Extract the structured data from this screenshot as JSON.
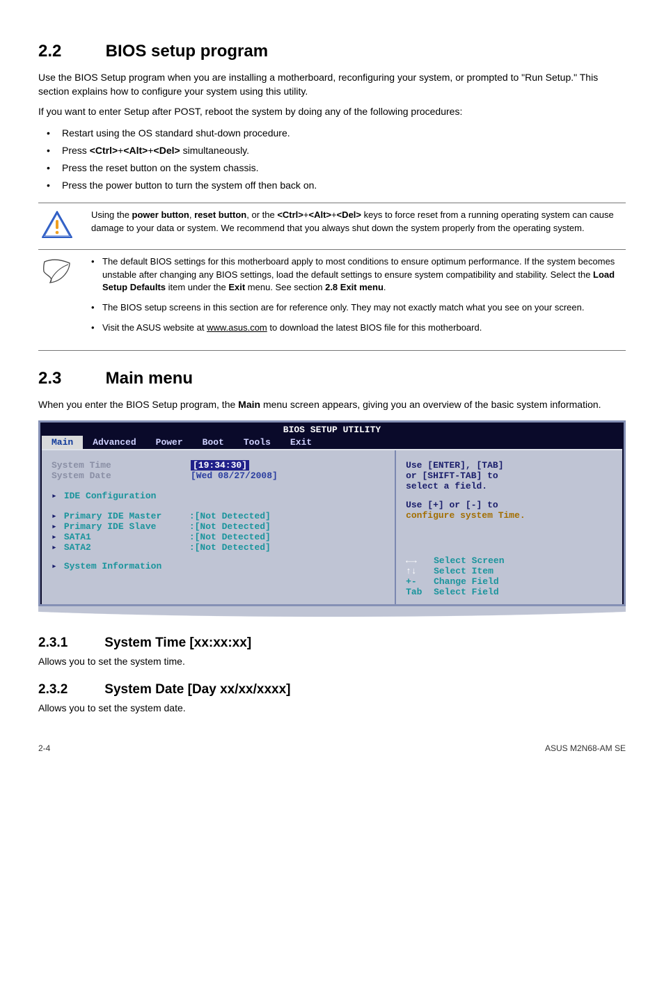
{
  "s22": {
    "num": "2.2",
    "title": "BIOS setup program",
    "p1": "Use the BIOS Setup program when you are installing a motherboard, reconfiguring your system, or prompted to \"Run Setup.\" This section explains how to configure your system using this utility.",
    "p2": "If you want to enter Setup after POST, reboot the system by doing any of the following procedures:",
    "bul": [
      "Restart using the OS standard shut-down procedure.",
      "",
      "Press the reset button on the system chassis.",
      "Press the power button to turn the system off then back on."
    ],
    "bul_ctrl_pre": "Press ",
    "bul_ctrl_a": "<Ctrl>",
    "bul_ctrl_b": "<Alt>",
    "bul_ctrl_c": "<Del>",
    "bul_ctrl_post": " simultaneously."
  },
  "warn": {
    "pre": "Using the ",
    "pb": "power button",
    "mid1": ", ",
    "rb": "reset button",
    "mid2": ", or the ",
    "k1": "<Ctrl>",
    "plus": "+",
    "k2": "<Alt>",
    "k3": "<Del>",
    "post": " keys to force reset from a running operating system can cause damage to your data or system. We recommend that you always shut down the system properly from the operating system."
  },
  "tips": {
    "i1_pre": "The default BIOS settings for this motherboard apply to most conditions to ensure optimum performance. If the system becomes unstable after changing any BIOS settings, load the default settings to ensure system compatibility and stability. Select the ",
    "i1_b1": "Load Setup Defaults",
    "i1_mid": " item under the ",
    "i1_b2": "Exit",
    "i1_mid2": " menu. See section ",
    "i1_b3": "2.8 Exit menu",
    "i1_post": ".",
    "i2": "The BIOS setup screens in this section are for reference only. They may not exactly match what you see on your screen.",
    "i3_pre": "Visit the ASUS website at ",
    "i3_link": "www.asus.com",
    "i3_post": " to download the latest BIOS file for this motherboard."
  },
  "s23": {
    "num": "2.3",
    "title": "Main menu",
    "p1_pre": "When you enter the BIOS Setup program, the ",
    "p1_b": "Main",
    "p1_post": " menu screen appears, giving you an overview of the basic system information."
  },
  "bios": {
    "title": "BIOS SETUP UTILITY",
    "tabs": [
      "Main",
      "Advanced",
      "Power",
      "Boot",
      "Tools",
      "Exit"
    ],
    "left": {
      "systime_l": "System Time",
      "systime_v": "[19:34:30]",
      "sysdate_l": "System Date",
      "sysdate_v": "[Wed 08/27/2008]",
      "idecfg": "IDE Configuration",
      "pm_l": "Primary IDE Master",
      "pm_v": ":[Not Detected]",
      "ps_l": "Primary IDE Slave",
      "ps_v": ":[Not Detected]",
      "s1_l": "SATA1",
      "s1_v": ":[Not Detected]",
      "s2_l": "SATA2",
      "s2_v": ":[Not Detected]",
      "sysinfo": "System Information"
    },
    "right": {
      "h1": "Use [ENTER], [TAB]",
      "h2": "or [SHIFT-TAB] to",
      "h3": "select a field.",
      "h4": "Use [+] or [-] to",
      "h5": "configure system Time.",
      "k1": "Select Screen",
      "k2": "Select Item",
      "k3": "Change Field",
      "k4": "Select Field",
      "kp1": "←→",
      "kp2": "↑↓",
      "kp3": "+-",
      "kp4": "Tab"
    }
  },
  "s231": {
    "num": "2.3.1",
    "title": "System Time [xx:xx:xx]",
    "p": "Allows you to set the system time."
  },
  "s232": {
    "num": "2.3.2",
    "title": "System Date [Day xx/xx/xxxx]",
    "p": "Allows you to set the system date."
  },
  "footer": {
    "left": "2-4",
    "right": "ASUS M2N68-AM SE"
  }
}
